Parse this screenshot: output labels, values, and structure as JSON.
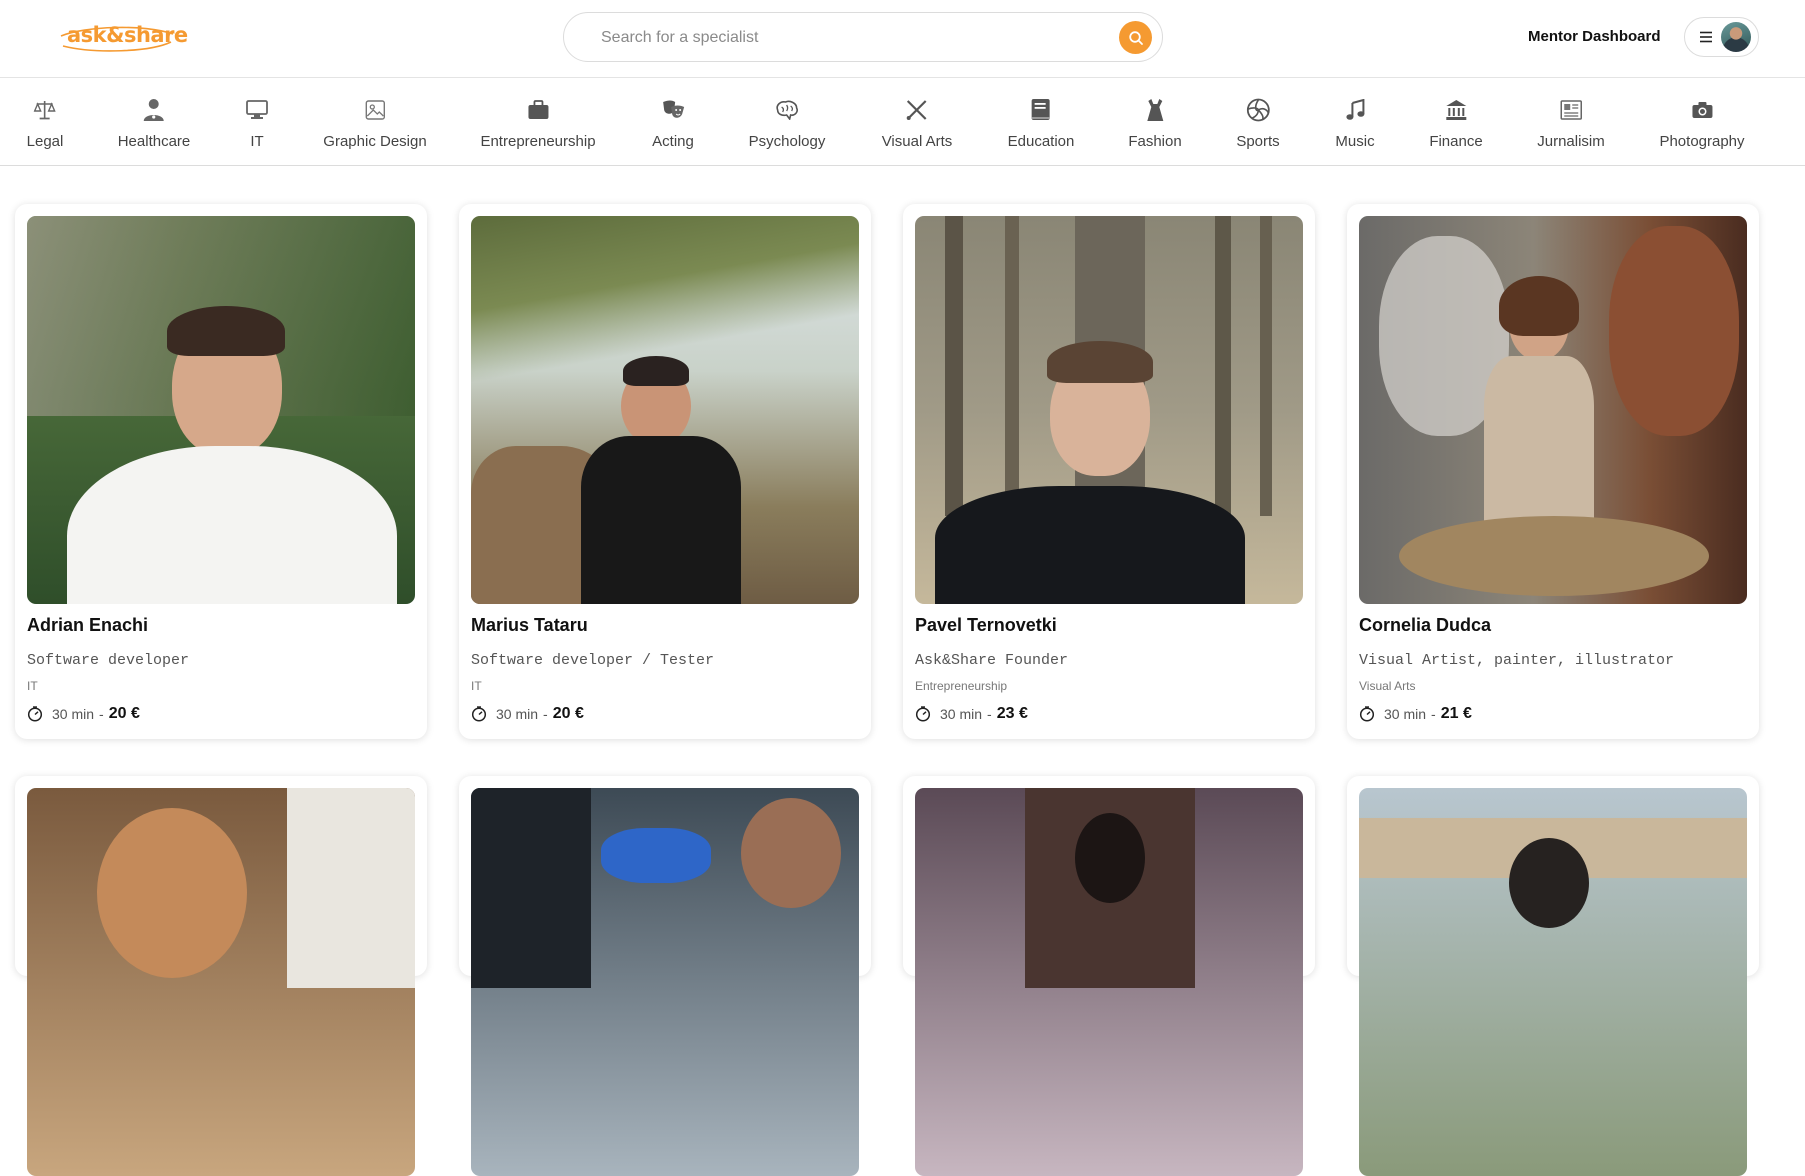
{
  "header": {
    "logo_text": "ask&share",
    "search_placeholder": "Search for a specialist",
    "mentor_dashboard_label": "Mentor Dashboard"
  },
  "categories": [
    {
      "label": "Legal",
      "icon": "scales-icon"
    },
    {
      "label": "Healthcare",
      "icon": "doctor-icon"
    },
    {
      "label": "IT",
      "icon": "monitor-icon"
    },
    {
      "label": "Graphic Design",
      "icon": "image-icon"
    },
    {
      "label": "Entrepreneurship",
      "icon": "briefcase-icon"
    },
    {
      "label": "Acting",
      "icon": "theater-masks-icon"
    },
    {
      "label": "Psychology",
      "icon": "brain-icon"
    },
    {
      "label": "Visual Arts",
      "icon": "brush-pencil-icon"
    },
    {
      "label": "Education",
      "icon": "book-icon"
    },
    {
      "label": "Fashion",
      "icon": "dress-icon"
    },
    {
      "label": "Sports",
      "icon": "volleyball-icon"
    },
    {
      "label": "Music",
      "icon": "music-note-icon"
    },
    {
      "label": "Finance",
      "icon": "bank-icon"
    },
    {
      "label": "Jurnalisim",
      "icon": "newspaper-icon"
    },
    {
      "label": "Photography",
      "icon": "camera-icon"
    }
  ],
  "mentors": [
    {
      "name": "Adrian Enachi",
      "role": "Software developer",
      "category": "IT",
      "duration": "30 min",
      "price": "20 €"
    },
    {
      "name": "Marius Tataru",
      "role": "Software developer / Tester",
      "category": "IT",
      "duration": "30 min",
      "price": "20 €"
    },
    {
      "name": "Pavel Ternovetki",
      "role": "Ask&Share Founder",
      "category": "Entrepreneurship",
      "duration": "30 min",
      "price": "23 €"
    },
    {
      "name": "Cornelia Dudca",
      "role": "Visual Artist, painter, illustrator",
      "category": "Visual Arts",
      "duration": "30 min",
      "price": "21 €"
    }
  ],
  "colors": {
    "accent": "#f59a31",
    "border": "#dcdcdc",
    "text": "#111111",
    "muted": "#555555"
  }
}
